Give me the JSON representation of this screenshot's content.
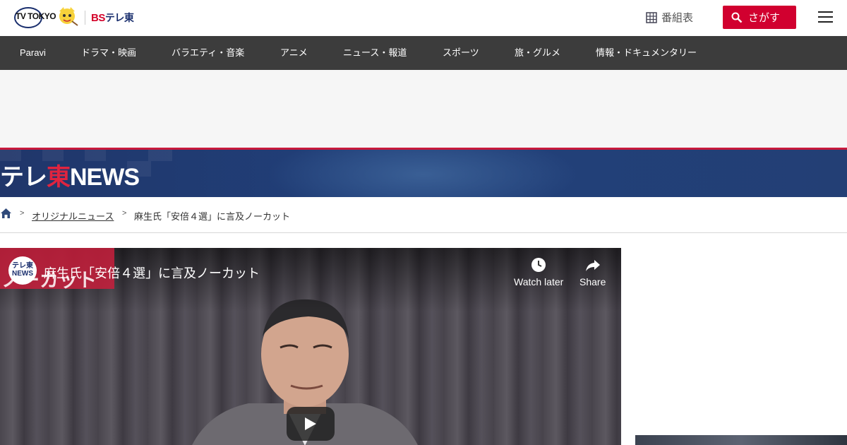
{
  "header": {
    "logo_primary": "TV TOKYO",
    "logo_secondary_bs": "BS",
    "logo_secondary_tele": "テレ東",
    "program_guide_label": "番組表",
    "search_label": "さがす"
  },
  "nav": {
    "items": [
      {
        "label": "Paravi"
      },
      {
        "label": "ドラマ・映画"
      },
      {
        "label": "バラエティ・音楽"
      },
      {
        "label": "アニメ"
      },
      {
        "label": "ニュース・報道"
      },
      {
        "label": "スポーツ"
      },
      {
        "label": "旅・グルメ"
      },
      {
        "label": "情報・ドキュメンタリー"
      }
    ]
  },
  "banner": {
    "logo_tele": "テレ",
    "logo_east": "東",
    "logo_news": "NEWS"
  },
  "breadcrumb": {
    "separator": ">",
    "category": "オリジナルニュース",
    "current": "麻生氏「安倍４選」に言及ノーカット"
  },
  "video": {
    "caption_overlay": "ノーカット",
    "channel_tele": "テレ東",
    "channel_news": "NEWS",
    "title": "麻生氏「安倍４選」に言及ノーカット",
    "watch_later_label": "Watch later",
    "share_label": "Share"
  },
  "colors": {
    "brand_red": "#d1002f",
    "nav_bg": "#3c3c3c",
    "banner_blue": "#21407a"
  }
}
